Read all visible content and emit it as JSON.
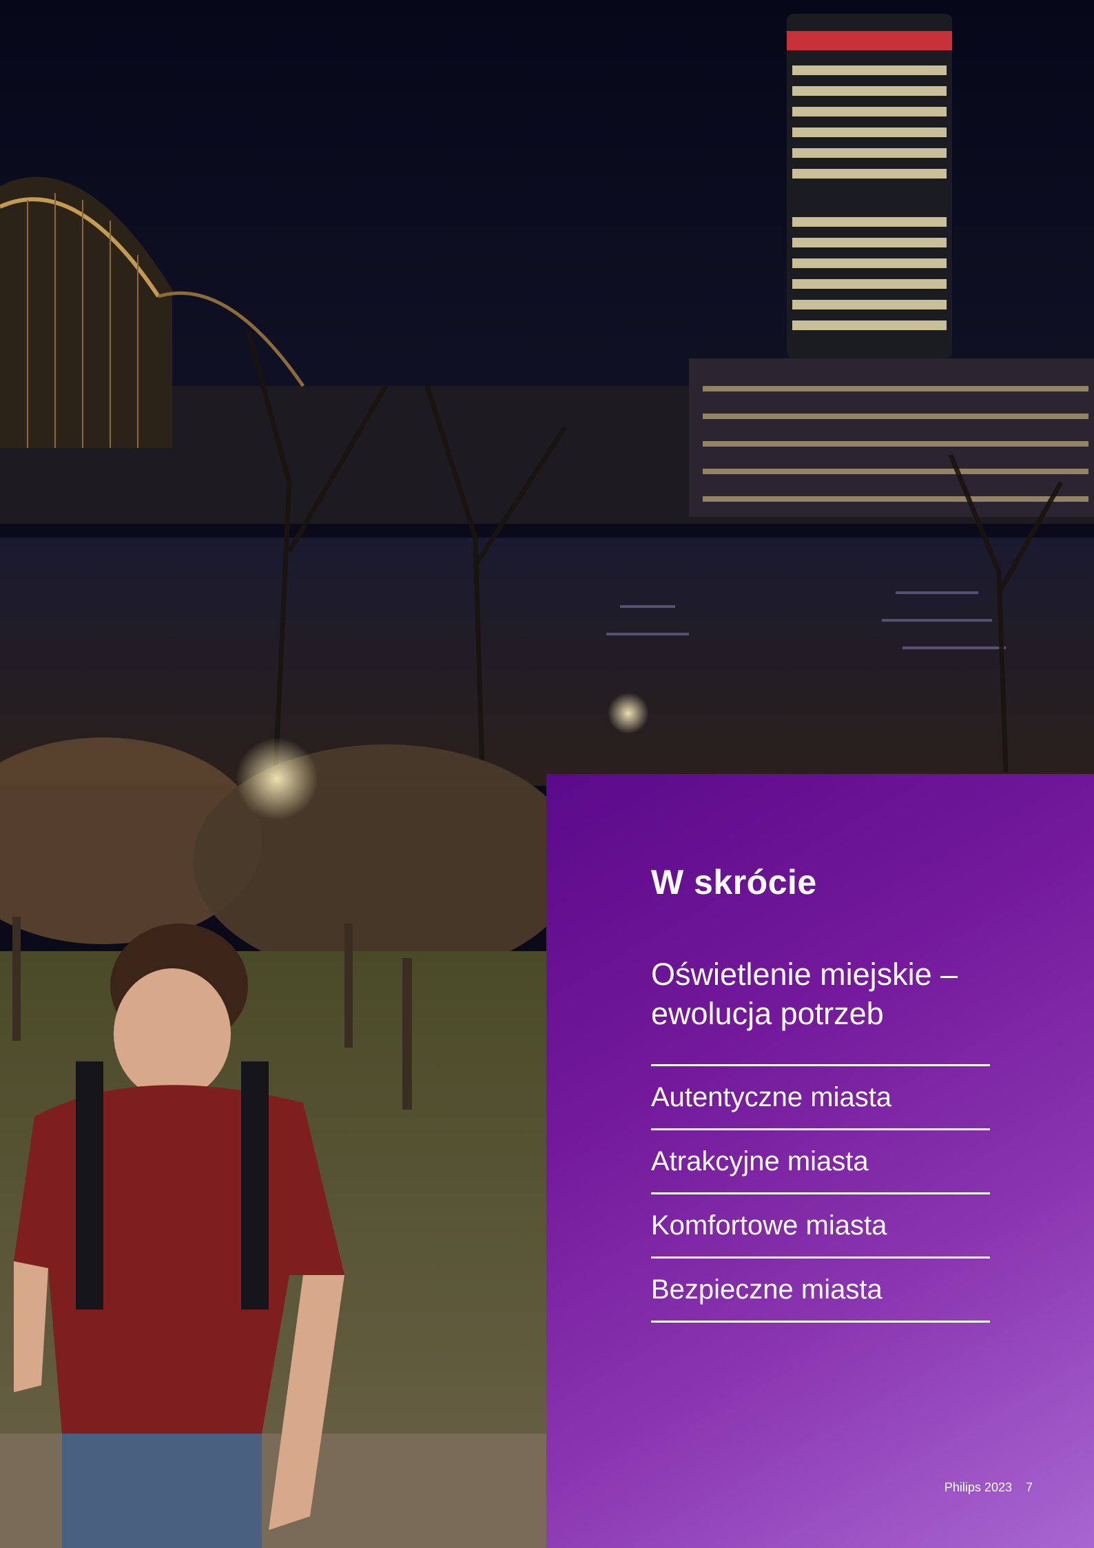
{
  "panel": {
    "title": "W skrócie",
    "subtitle": "Oświetlenie miejskie – ewolucja potrzeb",
    "items": [
      {
        "label": "Autentyczne miasta"
      },
      {
        "label": "Atrakcyjne miasta"
      },
      {
        "label": "Komfortowe miasta"
      },
      {
        "label": "Bezpieczne miasta"
      }
    ]
  },
  "footer": {
    "brand": "Philips 2023",
    "page_number": "7"
  },
  "colors": {
    "panel_start": "#5a0a8a",
    "panel_end": "#a866d1",
    "text": "#ffffff"
  }
}
